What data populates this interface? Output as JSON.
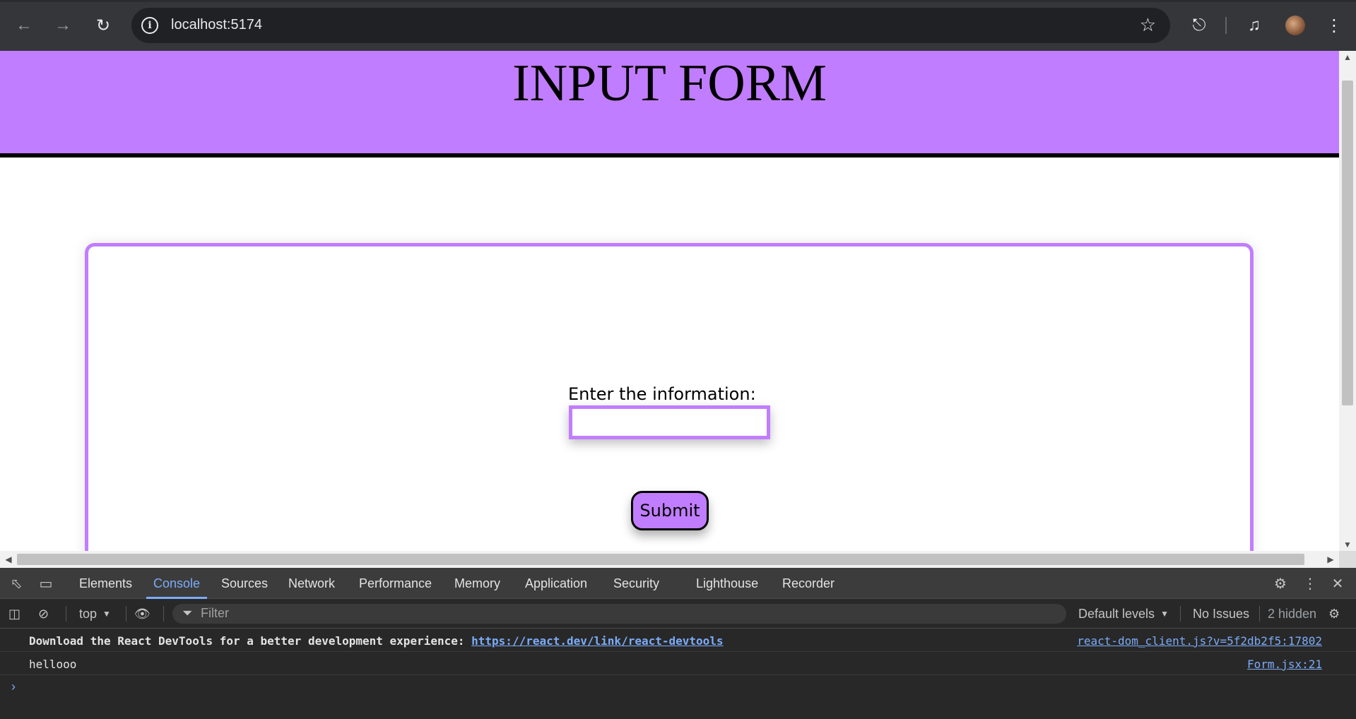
{
  "browser": {
    "url": "localhost:5174",
    "back_icon": "arrow-left-icon",
    "forward_icon": "arrow-right-icon",
    "reload_icon": "reload-icon"
  },
  "page": {
    "title": "INPUT FORM",
    "field_label": "Enter the information:",
    "field_value": "",
    "submit_label": "Submit",
    "accent": "#c17dff"
  },
  "devtools": {
    "tabs": [
      "Elements",
      "Console",
      "Sources",
      "Network",
      "Performance",
      "Memory",
      "Application",
      "Security",
      "Lighthouse",
      "Recorder"
    ],
    "active_tab": "Console",
    "context": "top",
    "filter_placeholder": "Filter",
    "levels": "Default levels",
    "issues": "No Issues",
    "hidden": "2 hidden",
    "logs": [
      {
        "message_prefix": "Download the React DevTools for a better development experience: ",
        "message_link": "https://react.dev/link/react-devtools",
        "source": "react-dom_client.js?v=5f2db2f5:17802"
      },
      {
        "message": "hellooo",
        "source": "Form.jsx:21"
      }
    ]
  }
}
